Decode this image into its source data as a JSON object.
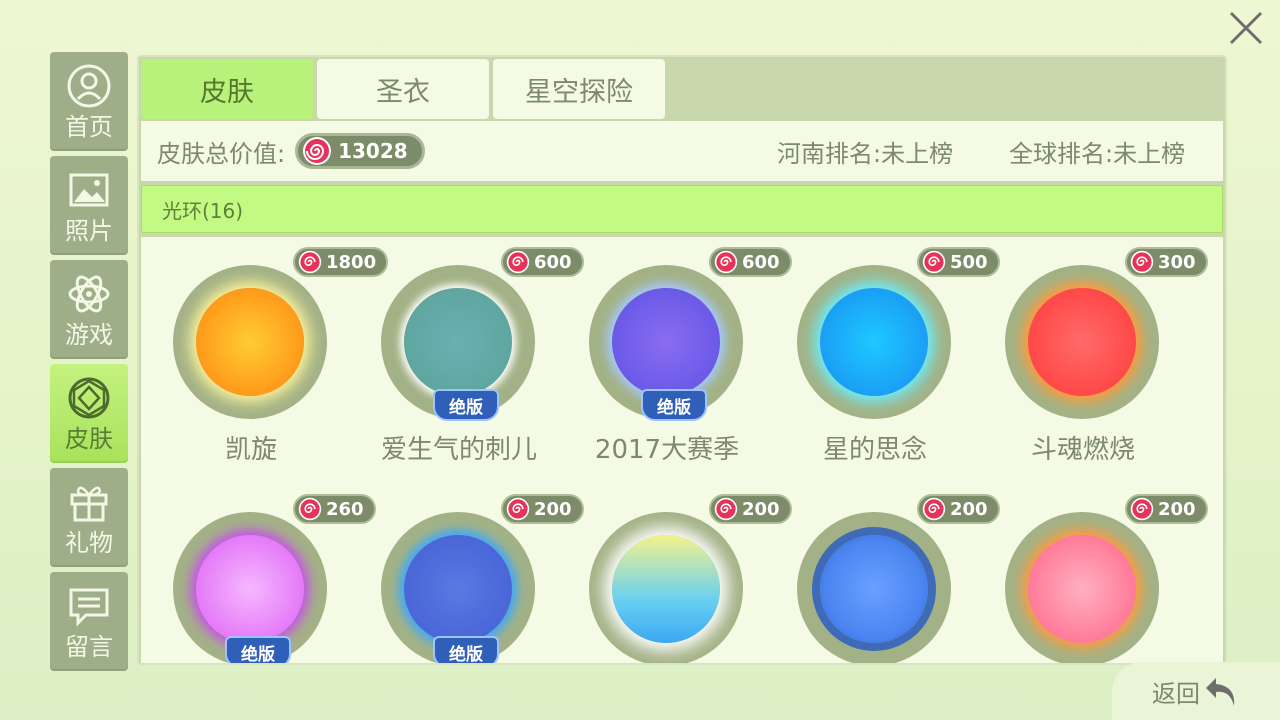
{
  "sidebar": {
    "items": [
      {
        "label": "首页",
        "icon": "user-icon",
        "active": false
      },
      {
        "label": "照片",
        "icon": "photo-icon",
        "active": false
      },
      {
        "label": "游戏",
        "icon": "atom-icon",
        "active": false
      },
      {
        "label": "皮肤",
        "icon": "gem-icon",
        "active": true
      },
      {
        "label": "礼物",
        "icon": "gift-icon",
        "active": false
      },
      {
        "label": "留言",
        "icon": "message-icon",
        "active": false
      }
    ]
  },
  "tabs": [
    {
      "label": "皮肤",
      "active": true
    },
    {
      "label": "圣衣",
      "active": false
    },
    {
      "label": "星空探险",
      "active": false
    }
  ],
  "info": {
    "total_label": "皮肤总价值:",
    "total_value": "13028",
    "henan_rank": "河南排名:未上榜",
    "global_rank": "全球排名:未上榜"
  },
  "category": {
    "label": "光环(16)"
  },
  "items": [
    {
      "price": "1800",
      "name": "凯旋",
      "badge": ""
    },
    {
      "price": "600",
      "name": "爱生气的刺儿",
      "badge": "绝版"
    },
    {
      "price": "600",
      "name": "2017大赛季",
      "badge": "绝版"
    },
    {
      "price": "500",
      "name": "星的思念",
      "badge": ""
    },
    {
      "price": "300",
      "name": "斗魂燃烧",
      "badge": ""
    },
    {
      "price": "260",
      "name": "",
      "badge": "绝版"
    },
    {
      "price": "200",
      "name": "",
      "badge": "绝版"
    },
    {
      "price": "200",
      "name": "",
      "badge": ""
    },
    {
      "price": "200",
      "name": "",
      "badge": ""
    },
    {
      "price": "200",
      "name": "",
      "badge": ""
    }
  ],
  "back": {
    "label": "返回"
  },
  "colors": {
    "accent": "#b8f27a",
    "panel": "#c8d8ac",
    "card": "#f4fae4"
  }
}
